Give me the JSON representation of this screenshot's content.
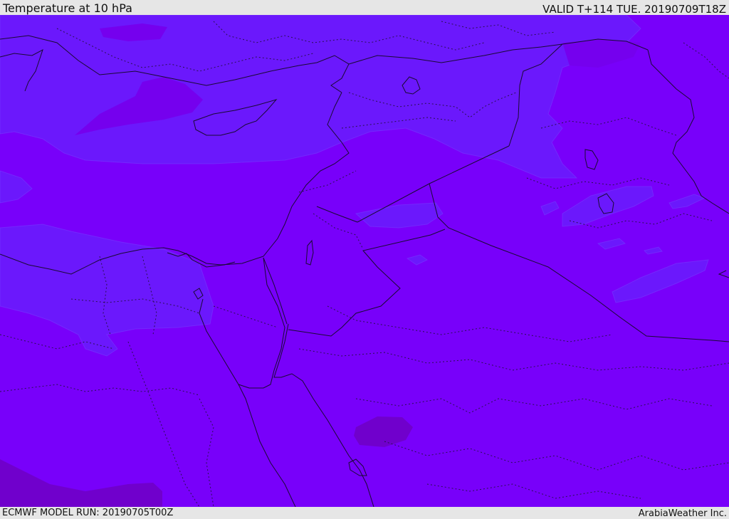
{
  "header": {
    "title": "Temperature at 10 hPa",
    "valid_time": "VALID T+114 TUE. 20190709T18Z"
  },
  "footer": {
    "model_run": "ECMWF MODEL RUN: 20190705T00Z",
    "credit": "ArabiaWeather Inc."
  },
  "map": {
    "variable": "temperature",
    "level": "10 hPa",
    "colors": {
      "base_fill": "#7800fa",
      "cooler_fill": "#6b18fc",
      "warmer_fill": "#7400d8",
      "warmest_fill": "#7000cc",
      "coastline": "#1a0a33",
      "border": "#1a0a33"
    }
  }
}
